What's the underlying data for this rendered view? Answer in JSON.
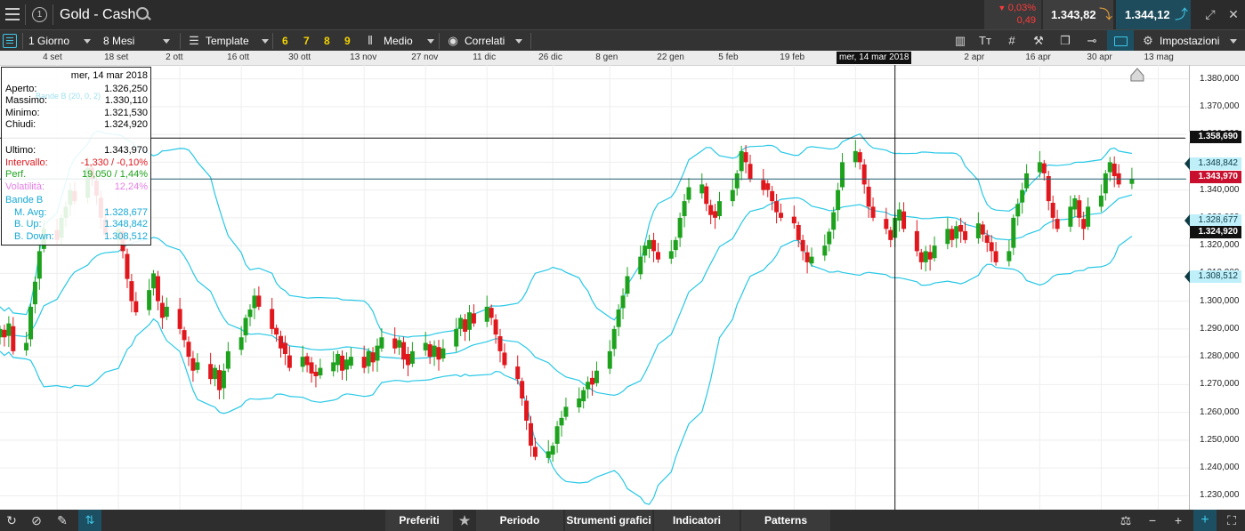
{
  "header": {
    "instrument": "Gold - Cash",
    "change_pct": "0,03%",
    "change_abs": "0,49",
    "bid": "1.343,82",
    "ask": "1.344,12"
  },
  "toolbar": {
    "timeframe": "1 Giorno",
    "range": "8 Mesi",
    "template": "Template",
    "presets": [
      "6",
      "7",
      "8",
      "9"
    ],
    "indicator": "Medio",
    "correlated": "Correlati",
    "settings": "Impostazioni"
  },
  "dates": [
    "4 set",
    "18 set",
    "2 ott",
    "16 ott",
    "30 ott",
    "13 nov",
    "27 nov",
    "11 dic",
    "26 dic",
    "8 gen",
    "22 gen",
    "5 feb",
    "19 feb",
    "mar",
    "2 apr",
    "16 apr",
    "30 apr",
    "13 mag"
  ],
  "crosshair_date": "mer, 14 mar 2018",
  "info": {
    "date": "mer, 14 mar 2018",
    "rows": [
      {
        "label": "Aperto:",
        "value": "1.326,250"
      },
      {
        "label": "Massimo:",
        "value": "1.330,110"
      },
      {
        "label": "Minimo:",
        "value": "1.321,530"
      },
      {
        "label": "Chiudi:",
        "value": "1.324,920"
      }
    ],
    "ultimo_label": "Ultimo:",
    "ultimo": "1.343,970",
    "intervallo_label": "Intervallo:",
    "intervallo": "-1,330 / -0,10%",
    "perf_label": "Perf.",
    "perf": "19,050 / 1,44%",
    "volatilita_label": "Volatilità:",
    "volatilita": "12,24%",
    "bande_title": "Bande B",
    "bande_ghost": "Bande B (20, 0, 2)",
    "bande": [
      {
        "label": "M. Avg:",
        "value": "1.328,677"
      },
      {
        "label": "B. Up:",
        "value": "1.348,842"
      },
      {
        "label": "B. Down:",
        "value": "1.308,512"
      }
    ]
  },
  "yaxis": [
    "1.380,000",
    "1.370,000",
    "1.360,000",
    "1.350,000",
    "1.340,000",
    "1.330,000",
    "1.320,000",
    "1.310,000",
    "1.300,000",
    "1.290,000",
    "1.280,000",
    "1.270,000",
    "1.260,000",
    "1.250,000",
    "1.240,000",
    "1.230,000"
  ],
  "tags": {
    "hline": "1.358,690",
    "bup": "1.348,842",
    "last": "1.343,970",
    "mavg": "1.328,677",
    "close": "1.324,920",
    "bdown": "1.308,512"
  },
  "bottom": {
    "preferiti": "Preferiti",
    "periodo": "Periodo",
    "strumenti": "Strumenti grafici",
    "indicatori": "Indicatori",
    "patterns": "Patterns"
  },
  "colors": {
    "up": "#1ea21e",
    "down": "#e0181e",
    "bands": "#28c8e6",
    "last_tag": "#c8102e"
  },
  "chart_data": {
    "type": "candlestick",
    "ylim": [
      1225,
      1385
    ],
    "x_start": "2017-08-22",
    "x_end": "2018-05-20",
    "x_ticks": [
      "2017-09-04",
      "2017-09-18",
      "2017-10-02",
      "2017-10-16",
      "2017-10-30",
      "2017-11-13",
      "2017-11-27",
      "2017-12-11",
      "2017-12-26",
      "2018-01-08",
      "2018-01-22",
      "2018-02-05",
      "2018-02-19",
      "2018-03-05",
      "2018-04-02",
      "2018-04-16",
      "2018-04-30",
      "2018-05-13"
    ],
    "crosshair_x": "2018-03-14",
    "hline": 1358.69,
    "last": 1343.97,
    "bands_latest": {
      "mavg": 1328.677,
      "up": 1348.842,
      "down": 1308.512
    },
    "closes": [
      1290,
      1287,
      1292,
      1282,
      1285,
      1298,
      1307,
      1318,
      1326,
      1322,
      1330,
      1334,
      1340,
      1336,
      1348,
      1344,
      1338,
      1330,
      1324,
      1326,
      1318,
      1308,
      1300,
      1296,
      1304,
      1310,
      1300,
      1294,
      1298,
      1290,
      1286,
      1280,
      1275,
      1278,
      1272,
      1276,
      1268,
      1275,
      1282,
      1287,
      1294,
      1297,
      1302,
      1298,
      1290,
      1288,
      1283,
      1281,
      1276,
      1280,
      1277,
      1274,
      1273,
      1276,
      1278,
      1281,
      1275,
      1279,
      1280,
      1276,
      1282,
      1278,
      1284,
      1287,
      1283,
      1286,
      1279,
      1277,
      1282,
      1285,
      1280,
      1284,
      1279,
      1283,
      1290,
      1294,
      1289,
      1296,
      1292,
      1298,
      1294,
      1288,
      1282,
      1277,
      1272,
      1265,
      1257,
      1248,
      1244,
      1246,
      1248,
      1255,
      1258,
      1262,
      1265,
      1268,
      1271,
      1270,
      1275,
      1282,
      1290,
      1297,
      1302,
      1309,
      1316,
      1320,
      1322,
      1318,
      1315,
      1318,
      1322,
      1330,
      1336,
      1341,
      1342,
      1335,
      1331,
      1330,
      1336,
      1340,
      1346,
      1354,
      1350,
      1344,
      1340,
      1340,
      1336,
      1332,
      1330,
      1328,
      1322,
      1318,
      1314,
      1316,
      1320,
      1325,
      1332,
      1340,
      1350,
      1354,
      1350,
      1342,
      1334,
      1330,
      1326,
      1322,
      1330,
      1333,
      1326,
      1318,
      1314,
      1318,
      1315,
      1320,
      1326,
      1322,
      1327,
      1325,
      1322,
      1328,
      1324,
      1321,
      1318,
      1314,
      1318,
      1330,
      1335,
      1340,
      1346,
      1350,
      1346,
      1336,
      1330,
      1326,
      1334,
      1337,
      1330,
      1326,
      1334,
      1338,
      1346,
      1350,
      1345,
      1342,
      1344
    ]
  }
}
